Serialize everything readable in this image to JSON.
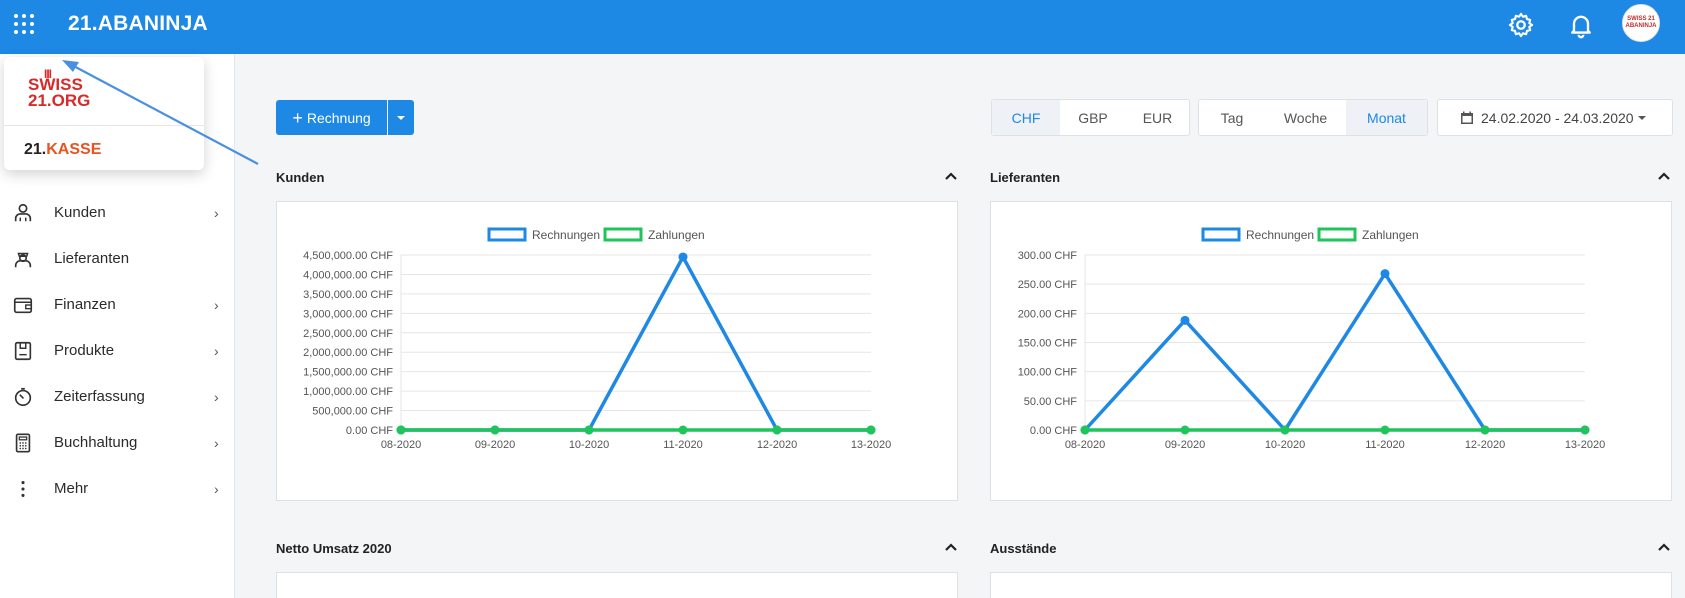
{
  "topbar": {
    "brand_prefix": "21.",
    "brand_name": "ABANINJA",
    "icons": [
      "apps-grid-icon",
      "gear-icon",
      "bell-icon"
    ],
    "avatar_text": "SWISS 21 ABANINJA"
  },
  "apps_popup": {
    "swiss_logo_text": "SWISS 21.ORG",
    "kasse_prefix": "21.",
    "kasse_name": "KASSE"
  },
  "sidebar": {
    "items": [
      {
        "label": "Kunden",
        "icon": "customer-icon",
        "has_submenu": true
      },
      {
        "label": "Lieferanten",
        "icon": "supplier-icon",
        "has_submenu": false
      },
      {
        "label": "Finanzen",
        "icon": "wallet-icon",
        "has_submenu": true
      },
      {
        "label": "Produkte",
        "icon": "box-icon",
        "has_submenu": true
      },
      {
        "label": "Zeiterfassung",
        "icon": "stopwatch-icon",
        "has_submenu": true
      },
      {
        "label": "Buchhaltung",
        "icon": "calculator-icon",
        "has_submenu": true
      },
      {
        "label": "Mehr",
        "icon": "more-icon",
        "has_submenu": true
      }
    ]
  },
  "toolbar": {
    "new_button_label": "Rechnung",
    "currencies": [
      "CHF",
      "GBP",
      "EUR"
    ],
    "active_currency": "CHF",
    "periods": [
      "Tag",
      "Woche",
      "Monat"
    ],
    "active_period": "Monat",
    "date_range": "24.02.2020 - 24.03.2020"
  },
  "panels": {
    "kunden_title": "Kunden",
    "lieferanten_title": "Lieferanten",
    "netto_title": "Netto Umsatz 2020",
    "ausstaende_title": "Ausstände"
  },
  "colors": {
    "accent": "#1e88e5",
    "rechnungen": "#1e88e5",
    "zahlungen": "#1fc45a"
  },
  "chart_data": [
    {
      "type": "line",
      "legend": [
        "Rechnungen",
        "Zahlungen"
      ],
      "legend_position": "top-center",
      "grid": true,
      "categories": [
        "08-2020",
        "09-2020",
        "10-2020",
        "11-2020",
        "12-2020",
        "13-2020"
      ],
      "yticks": [
        "4,500,000.00 CHF",
        "4,000,000.00 CHF",
        "3,500,000.00 CHF",
        "3,000,000.00 CHF",
        "2,500,000.00 CHF",
        "2,000,000.00 CHF",
        "1,500,000.00 CHF",
        "1,000,000.00 CHF",
        "500,000.00 CHF",
        "0.00 CHF"
      ],
      "ylim": [
        0,
        4500000
      ],
      "series": [
        {
          "name": "Rechnungen",
          "values": [
            0,
            0,
            0,
            4450000,
            0,
            0
          ]
        },
        {
          "name": "Zahlungen",
          "values": [
            0,
            0,
            0,
            0,
            0,
            0
          ]
        }
      ]
    },
    {
      "type": "line",
      "legend": [
        "Rechnungen",
        "Zahlungen"
      ],
      "legend_position": "top-center",
      "grid": true,
      "categories": [
        "08-2020",
        "09-2020",
        "10-2020",
        "11-2020",
        "12-2020",
        "13-2020"
      ],
      "yticks": [
        "300.00 CHF",
        "250.00 CHF",
        "200.00 CHF",
        "150.00 CHF",
        "100.00 CHF",
        "50.00 CHF",
        "0.00 CHF"
      ],
      "ylim": [
        0,
        300
      ],
      "series": [
        {
          "name": "Rechnungen",
          "values": [
            0,
            188,
            0,
            268,
            0,
            0
          ]
        },
        {
          "name": "Zahlungen",
          "values": [
            0,
            0,
            0,
            0,
            0,
            0
          ]
        }
      ]
    }
  ]
}
